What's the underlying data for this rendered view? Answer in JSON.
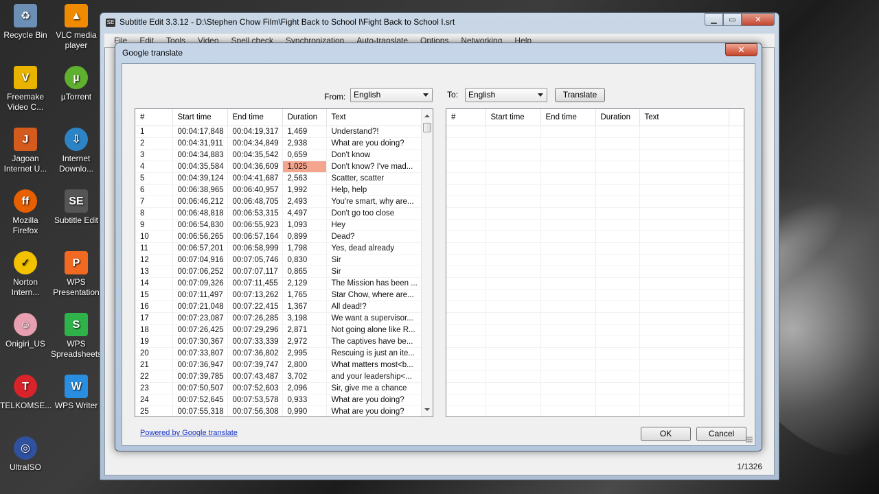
{
  "desktop": {
    "icons": [
      {
        "label": "Recycle Bin",
        "icon": "recycle-bin-icon",
        "color": "#6c8fb5"
      },
      {
        "label": "VLC media player",
        "icon": "vlc-icon",
        "color": "#f08a00"
      },
      {
        "label": "Freemake Video C...",
        "icon": "freemake-icon",
        "color": "#e8b400"
      },
      {
        "label": "µTorrent",
        "icon": "utorrent-icon",
        "color": "#5fb02f"
      },
      {
        "label": "Jagoan Internet U...",
        "icon": "jagoan-icon",
        "color": "#d45a1e"
      },
      {
        "label": "Internet Downlo...",
        "icon": "internet-download-icon",
        "color": "#2c83c6"
      },
      {
        "label": "Mozilla Firefox",
        "icon": "firefox-icon",
        "color": "#e66000"
      },
      {
        "label": "Subtitle Edit",
        "icon": "subtitle-edit-icon",
        "color": "#555555"
      },
      {
        "label": "Norton Intern...",
        "icon": "norton-icon",
        "color": "#f2c200"
      },
      {
        "label": "WPS Presentation",
        "icon": "wps-presentation-icon",
        "color": "#f26a21"
      },
      {
        "label": "Onigiri_US",
        "icon": "onigiri-icon",
        "color": "#e8a0b0"
      },
      {
        "label": "WPS Spreadsheets",
        "icon": "wps-spreadsheets-icon",
        "color": "#2fb24a"
      },
      {
        "label": "TELKOMSE...",
        "icon": "telkomsel-icon",
        "color": "#d8232a"
      },
      {
        "label": "WPS Writer",
        "icon": "wps-writer-icon",
        "color": "#2a8ee0"
      },
      {
        "label": "UltraISO",
        "icon": "ultraiso-icon",
        "color": "#3050a0"
      }
    ]
  },
  "main_window": {
    "title": "Subtitle Edit 3.3.12 - D:\\Stephen Chow Film\\Fight Back to School I\\Fight Back to School I.srt",
    "menu": [
      "File",
      "Edit",
      "Tools",
      "Video",
      "Spell check",
      "Synchronization",
      "Auto-translate",
      "Options",
      "Networking",
      "Help"
    ],
    "status_count": "1/1326"
  },
  "dialog": {
    "title": "Google translate",
    "close_label": "✕",
    "from_label": "From:",
    "from_value": "English",
    "to_label": "To:",
    "to_value": "English",
    "translate_button": "Translate",
    "columns": [
      "#",
      "Start time",
      "End time",
      "Duration",
      "Text"
    ],
    "rows": [
      [
        "1",
        "00:04:17,848",
        "00:04:19,317",
        "1,469",
        "Understand?!"
      ],
      [
        "2",
        "00:04:31,911",
        "00:04:34,849",
        "2,938",
        "What are you doing?"
      ],
      [
        "3",
        "00:04:34,883",
        "00:04:35,542",
        "0,659",
        "Don't know"
      ],
      [
        "4",
        "00:04:35,584",
        "00:04:36,609",
        "1,025",
        "Don't know? I've mad..."
      ],
      [
        "5",
        "00:04:39,124",
        "00:04:41,687",
        "2,563",
        "Scatter, scatter"
      ],
      [
        "6",
        "00:06:38,965",
        "00:06:40,957",
        "1,992",
        "Help, help"
      ],
      [
        "7",
        "00:06:46,212",
        "00:06:48,705",
        "2,493",
        "You're smart, why are..."
      ],
      [
        "8",
        "00:06:48,818",
        "00:06:53,315",
        "4,497",
        "Don't go too close"
      ],
      [
        "9",
        "00:06:54,830",
        "00:06:55,923",
        "1,093",
        "Hey"
      ],
      [
        "10",
        "00:06:56,265",
        "00:06:57,164",
        "0,899",
        "Dead?"
      ],
      [
        "11",
        "00:06:57,201",
        "00:06:58,999",
        "1,798",
        "Yes, dead already"
      ],
      [
        "12",
        "00:07:04,916",
        "00:07:05,746",
        "0,830",
        "Sir"
      ],
      [
        "13",
        "00:07:06,252",
        "00:07:07,117",
        "0,865",
        "Sir"
      ],
      [
        "14",
        "00:07:09,326",
        "00:07:11,455",
        "2,129",
        "The Mission has been ..."
      ],
      [
        "15",
        "00:07:11,497",
        "00:07:13,262",
        "1,765",
        "Star Chow, where are..."
      ],
      [
        "16",
        "00:07:21,048",
        "00:07:22,415",
        "1,367",
        "All dead!?"
      ],
      [
        "17",
        "00:07:23,087",
        "00:07:26,285",
        "3,198",
        "We want a supervisor..."
      ],
      [
        "18",
        "00:07:26,425",
        "00:07:29,296",
        "2,871",
        "Not going alone like R..."
      ],
      [
        "19",
        "00:07:30,367",
        "00:07:33,339",
        "2,972",
        "The captives have be..."
      ],
      [
        "20",
        "00:07:33,807",
        "00:07:36,802",
        "2,995",
        "Rescuing is just an ite..."
      ],
      [
        "21",
        "00:07:36,947",
        "00:07:39,747",
        "2,800",
        "What matters most<b..."
      ],
      [
        "22",
        "00:07:39,785",
        "00:07:43,487",
        "3,702",
        "and your leadership<..."
      ],
      [
        "23",
        "00:07:50,507",
        "00:07:52,603",
        "2,096",
        "Sir, give me a chance"
      ],
      [
        "24",
        "00:07:52,645",
        "00:07:53,578",
        "0,933",
        "What are you doing?"
      ],
      [
        "25",
        "00:07:55,318",
        "00:07:56,308",
        "0,990",
        "What are you doing?"
      ]
    ],
    "highlight_row": 4,
    "powered_by": "Powered by Google translate",
    "ok_label": "OK",
    "cancel_label": "Cancel"
  },
  "colors": {
    "highlight_cell": "#f4a58e",
    "link": "#1a36c4"
  }
}
